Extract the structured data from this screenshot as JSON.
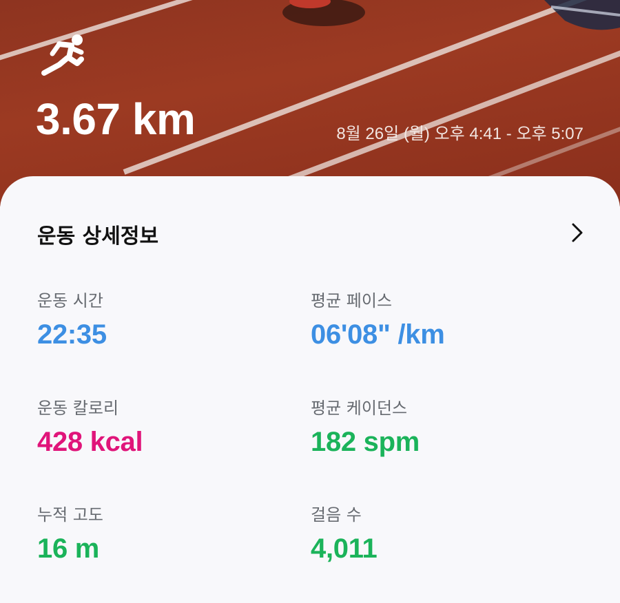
{
  "workout": {
    "activity_icon": "running-figure-icon",
    "distance": "3.67 km",
    "time_range": "8월 26일 (월) 오후 4:41 - 오후 5:07"
  },
  "details": {
    "title": "운동 상세정보",
    "chevron_icon": "chevron-right-icon",
    "stats": [
      {
        "label": "운동 시간",
        "value": "22:35",
        "color": "#3d8fe3"
      },
      {
        "label": "평균 페이스",
        "value": "06'08\" /km",
        "color": "#3d8fe3"
      },
      {
        "label": "운동 칼로리",
        "value": "428 kcal",
        "color": "#e0157a"
      },
      {
        "label": "평균 케이던스",
        "value": "182 spm",
        "color": "#1bb35a"
      },
      {
        "label": "누적 고도",
        "value": "16 m",
        "color": "#1bb35a"
      },
      {
        "label": "걸음 수",
        "value": "4,011",
        "color": "#1bb35a"
      }
    ]
  }
}
